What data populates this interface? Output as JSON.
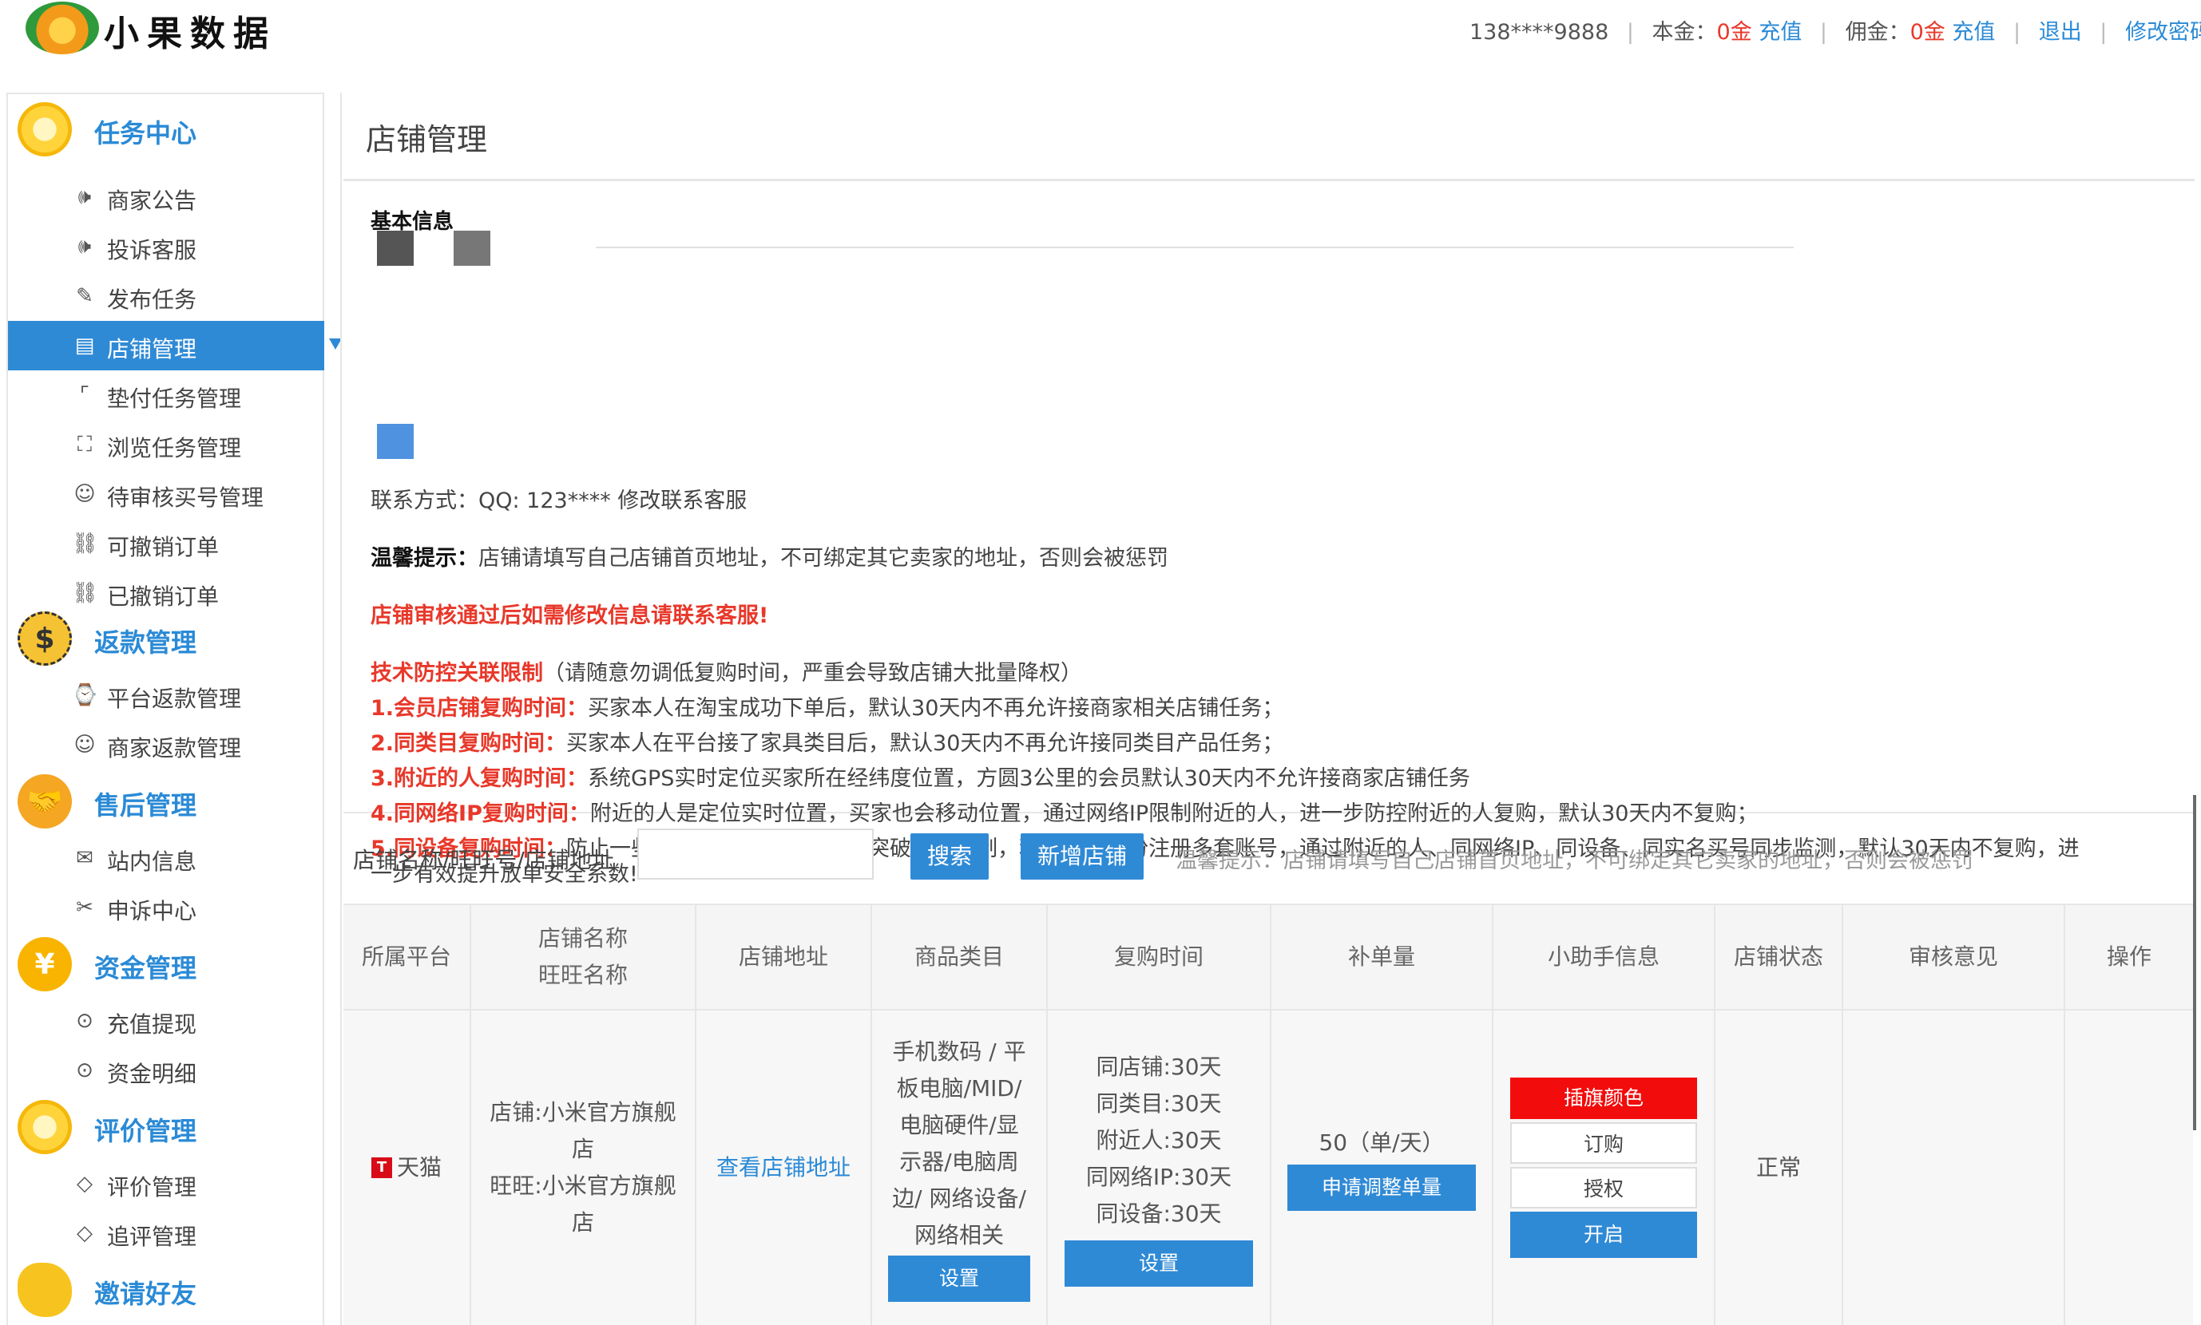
{
  "header": {
    "logo_text": "小果数据",
    "phone": "138****9888",
    "principal_label": "本金：",
    "principal_value": "0金",
    "recharge1": "充值",
    "commission_label": "佣金：",
    "commission_value": "0金",
    "recharge2": "充值",
    "logout": "退出",
    "change_password": "修改密码",
    "sep": "|"
  },
  "sidebar": {
    "sections": [
      {
        "title": "任务中心",
        "items": [
          "商家公告",
          "投诉客服",
          "发布任务",
          "店铺管理",
          "垫付任务管理",
          "浏览任务管理",
          "待审核买号管理",
          "可撤销订单",
          "已撤销订单"
        ]
      },
      {
        "title": "返款管理",
        "items": [
          "平台返款管理",
          "商家返款管理"
        ]
      },
      {
        "title": "售后管理",
        "items": [
          "站内信息",
          "申诉中心"
        ]
      },
      {
        "title": "资金管理",
        "items": [
          "充值提现",
          "资金明细"
        ]
      },
      {
        "title": "评价管理",
        "items": [
          "评价管理",
          "追评管理"
        ]
      },
      {
        "title": "邀请好友",
        "items": []
      }
    ],
    "active_item": "店铺管理",
    "dollar_glyph": "$",
    "yen_glyph": "¥"
  },
  "main": {
    "page_title": "店铺管理",
    "basic_info_title": "基本信息",
    "contact_line": "联系方式：QQ: 123****  修改联系客服",
    "tip_label": "温馨提示：",
    "tip_text": "店铺请填写自己店铺首页地址，不可绑定其它卖家的地址，否则会被惩罚",
    "review_notice": "店铺审核通过后如需修改信息请联系客服!",
    "rules_title": "技术防控关联限制",
    "rules_title_note": "（请随意勿调低复购时间，严重会导致店铺大批量降权）",
    "rules": [
      {
        "label": "1.会员店铺复购时间：",
        "text": "买家本人在淘宝成功下单后，默认30天内不再允许接商家相关店铺任务；"
      },
      {
        "label": "2.同类目复购时间：",
        "text": "买家本人在平台接了家具类目后，默认30天内不再允许接同类目产品任务；"
      },
      {
        "label": "3.附近的人复购时间：",
        "text": "系统GPS实时定位买家所在经纬度位置，方圆3公里的会员默认30天内不允许接商家店铺任务"
      },
      {
        "label": "4.同网络IP复购时间：",
        "text": "附近的人是定位实时位置，买家也会移动位置，通过网络IP限制附近的人，进一步防控附近的人复购，默认30天内不复购；"
      },
      {
        "label": "5.同设备复购时间：",
        "text": "防止一些不法会员通过技术手段突破关联限制，利用爸妈身份注册多套账号，通过附近的人、同网络IP、同设备、同实名买号同步监测，默认30天内不复购，进"
      }
    ],
    "rule5_cont": "一步有效提升放单安全系数!",
    "search_label": "店铺名称/旺旺号/店铺地址",
    "search_value": "",
    "search_button": "搜索",
    "add_button": "新增店铺",
    "search_tip": "温馨提示：店铺请填写自己店铺首页地址，不可绑定其它卖家的地址，否则会被惩罚"
  },
  "table": {
    "headers": [
      "所属平台",
      "店铺名称",
      "旺旺名称",
      "店铺地址",
      "商品类目",
      "复购时间",
      "补单量",
      "小助手信息",
      "店铺状态",
      "审核意见",
      "操作"
    ],
    "row": {
      "platform_icon": "T",
      "platform": "天猫",
      "shop_name_1": "店铺:小米官方旗舰",
      "shop_name_2": "店",
      "wangwang_1": "旺旺:小米官方旗舰",
      "wangwang_2": "店",
      "address_link": "查看店铺地址",
      "category_lines": [
        "手机数码 / 平",
        "板电脑/MID/",
        "电脑硬件/显",
        "示器/电脑周",
        "边/ 网络设备/",
        "网络相关"
      ],
      "category_button": "设置",
      "repurchase_lines": [
        "同店铺:30天",
        "同类目:30天",
        "附近人:30天",
        "同网络IP:30天",
        "同设备:30天"
      ],
      "repurchase_button": "设置",
      "volume": "50（单/天）",
      "volume_button": "申请调整单量",
      "assistant_buttons": [
        "插旗颜色",
        "订购",
        "授权",
        "开启"
      ],
      "status": "正常",
      "review": "",
      "operation": ""
    }
  },
  "colors": {
    "accent": "#2f8ad6",
    "link": "#2a8ad6",
    "alert": "#e8382a",
    "flag": "#f20c0c"
  }
}
